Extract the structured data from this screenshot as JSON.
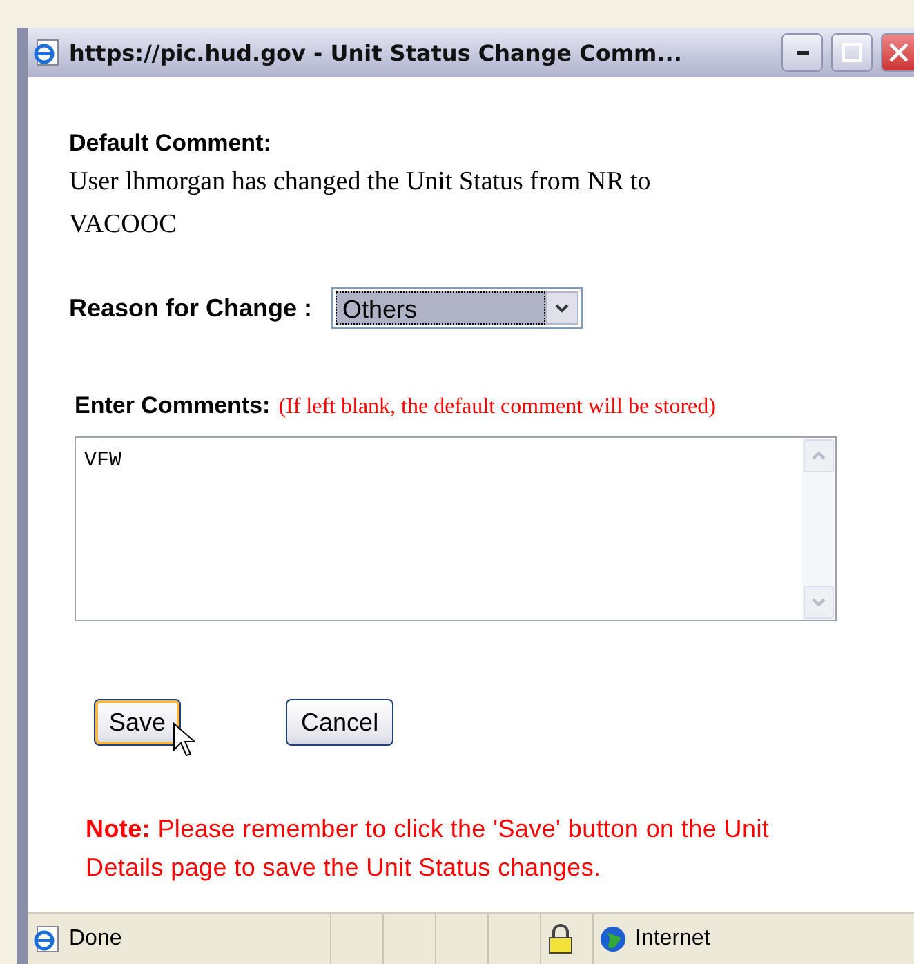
{
  "window": {
    "title": "https://pic.hud.gov - Unit Status Change Comm..."
  },
  "default_comment": {
    "label": "Default Comment:",
    "text": "User lhmorgan has changed the Unit Status from NR to VACOOC"
  },
  "reason": {
    "label": "Reason for Change :",
    "value": "Others",
    "focused": true
  },
  "comments": {
    "label": "Enter Comments:",
    "hint": "(If left blank, the default comment will be stored)",
    "value": "VFW"
  },
  "buttons": [
    {
      "label": "Save",
      "focused": true
    },
    {
      "label": "Cancel",
      "focused": false
    }
  ],
  "note": "**Note:**  Please remember to click the 'Save' button on the Unit Details page to save the Unit Status changes.",
  "status_bar": {
    "text": "Done",
    "zone": "Internet",
    "secure": true
  }
}
